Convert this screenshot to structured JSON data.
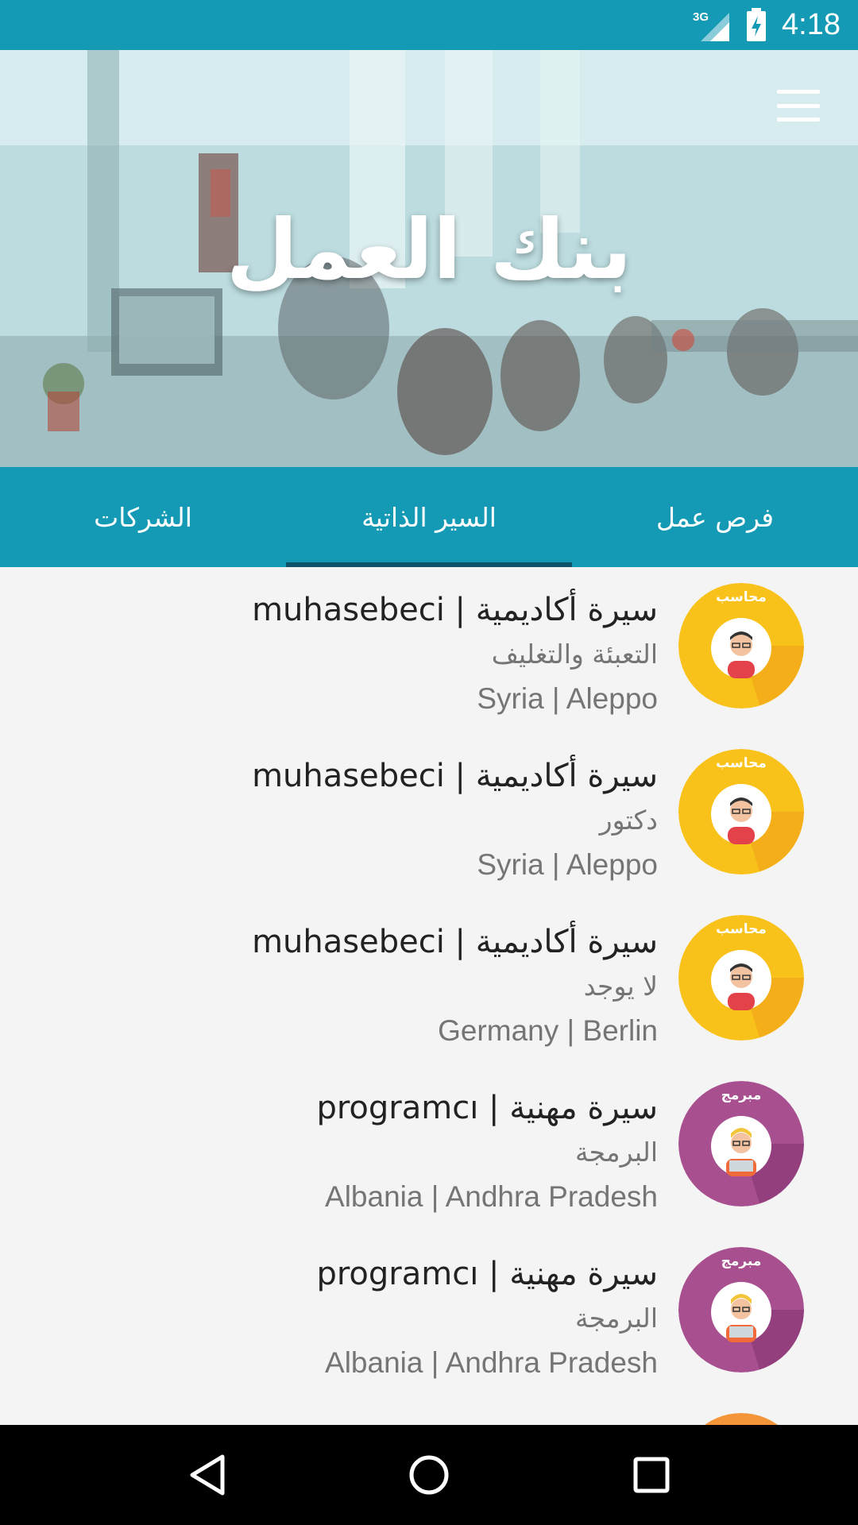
{
  "status_bar": {
    "network": "3G",
    "time": "4:18"
  },
  "header": {
    "title": "بنك العمل",
    "menu_icon": "hamburger-menu-icon"
  },
  "tabs": [
    {
      "label": "فرص عمل",
      "active": false
    },
    {
      "label": "السير الذاتية",
      "active": true
    },
    {
      "label": "الشركات",
      "active": false
    }
  ],
  "resumes": [
    {
      "title": "muhasebeci | سيرة أكاديمية",
      "subtitle": "التعبئة والتغليف",
      "location": "Syria | Aleppo",
      "avatar_label": "محاسب",
      "avatar_color": "#f9c21a"
    },
    {
      "title": "muhasebeci | سيرة أكاديمية",
      "subtitle": "دكتور",
      "location": "Syria | Aleppo",
      "avatar_label": "محاسب",
      "avatar_color": "#f9c21a"
    },
    {
      "title": "muhasebeci | سيرة أكاديمية",
      "subtitle": "لا يوجد",
      "location": "Germany | Berlin",
      "avatar_label": "محاسب",
      "avatar_color": "#f9c21a"
    },
    {
      "title": "programcı | سيرة مهنية",
      "subtitle": "البرمجة",
      "location": "Albania | Andhra Pradesh",
      "avatar_label": "مبرمج",
      "avatar_color": "#a8508f"
    },
    {
      "title": "programcı | سيرة مهنية",
      "subtitle": "البرمجة",
      "location": "Albania | Andhra Pradesh",
      "avatar_label": "مبرمج",
      "avatar_color": "#a8508f"
    }
  ],
  "colors": {
    "primary": "#149ab5",
    "tab_indicator": "#11546a",
    "accountant": "#f9c21a",
    "programmer": "#a8508f",
    "partial_next": "#f5953a"
  },
  "nav": {
    "back_icon": "back-triangle-icon",
    "home_icon": "home-circle-icon",
    "recents_icon": "recents-square-icon"
  }
}
